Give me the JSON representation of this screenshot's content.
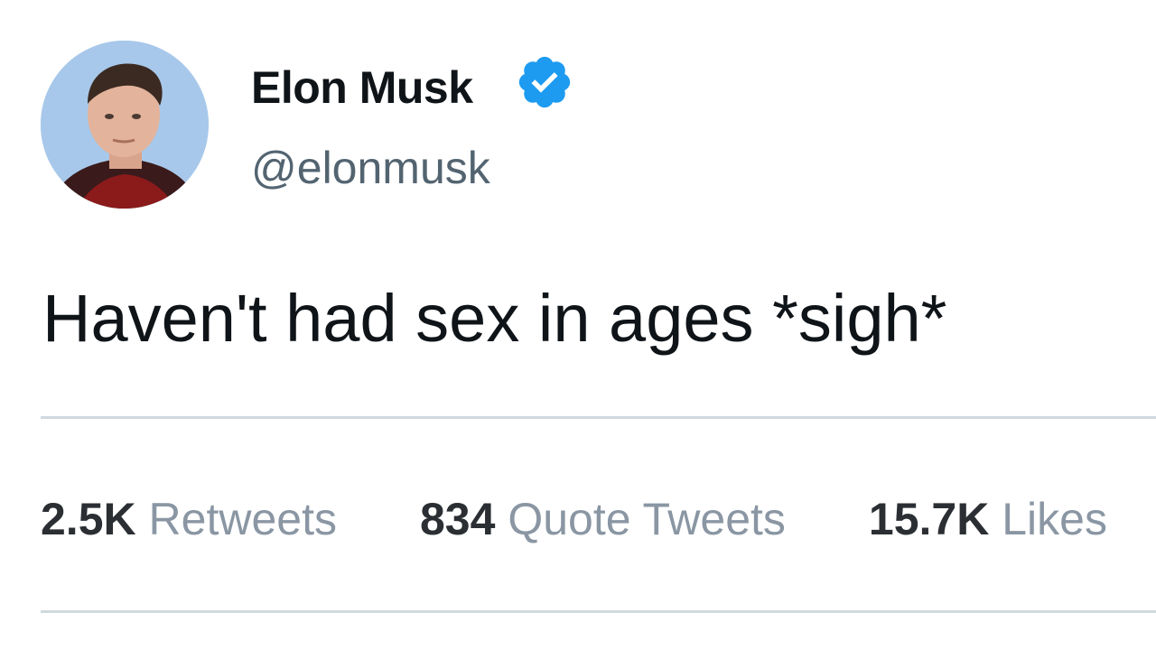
{
  "author": {
    "display_name": "Elon Musk",
    "handle": "@elonmusk",
    "verified": true,
    "avatar_icon": "profile-photo"
  },
  "tweet": {
    "text": "Haven't had sex in ages *sigh*"
  },
  "stats": [
    {
      "count": "2.5K",
      "label": "Retweets"
    },
    {
      "count": "834",
      "label": "Quote Tweets"
    },
    {
      "count": "15.7K",
      "label": "Likes"
    }
  ],
  "colors": {
    "verified_badge": "#1d9bf0",
    "name_text": "#0f1419",
    "handle_text": "#536471",
    "divider": "#cfd9de",
    "stat_label": "#8a96a3"
  }
}
